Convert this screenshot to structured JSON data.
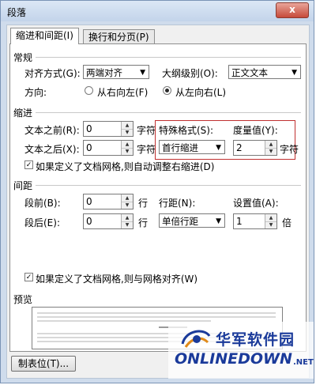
{
  "window": {
    "title": "段落",
    "close_label": "x"
  },
  "tabs": [
    {
      "label": "缩进和间距(I)"
    },
    {
      "label": "换行和分页(P)"
    }
  ],
  "general": {
    "heading": "常规",
    "alignment_label": "对齐方式(G):",
    "alignment_value": "两端对齐",
    "outline_label": "大纲级别(O):",
    "outline_value": "正文文本",
    "direction_label": "方向:",
    "rtl_label": "从右向左(F)",
    "ltr_label": "从左向右(L)"
  },
  "indent": {
    "heading": "缩进",
    "before_label": "文本之前(R):",
    "before_value": "0",
    "before_unit": "字符",
    "after_label": "文本之后(X):",
    "after_value": "0",
    "after_unit": "字符",
    "special_label": "特殊格式(S):",
    "special_value": "首行缩进",
    "measure_label": "度量值(Y):",
    "measure_value": "2",
    "measure_unit": "字符",
    "auto_adjust_label": "如果定义了文档网格,则自动调整右缩进(D)"
  },
  "spacing": {
    "heading": "间距",
    "before_label": "段前(B):",
    "before_value": "0",
    "before_unit": "行",
    "after_label": "段后(E):",
    "after_value": "0",
    "after_unit": "行",
    "line_label": "行距(N):",
    "line_value": "单倍行距",
    "setting_label": "设置值(A):",
    "setting_value": "1",
    "setting_unit": "倍",
    "snap_grid_label": "如果定义了文档网格,则与网格对齐(W)"
  },
  "preview": {
    "heading": "预览"
  },
  "tabs_button": {
    "label": "制表位(T)..."
  },
  "watermark": {
    "cn_text": "华军软件园",
    "en_text": "ONLINEDOWN",
    "net_text": ".NET"
  },
  "colors": {
    "highlight_box": "#c03030",
    "watermark": "#1a3a9a"
  }
}
